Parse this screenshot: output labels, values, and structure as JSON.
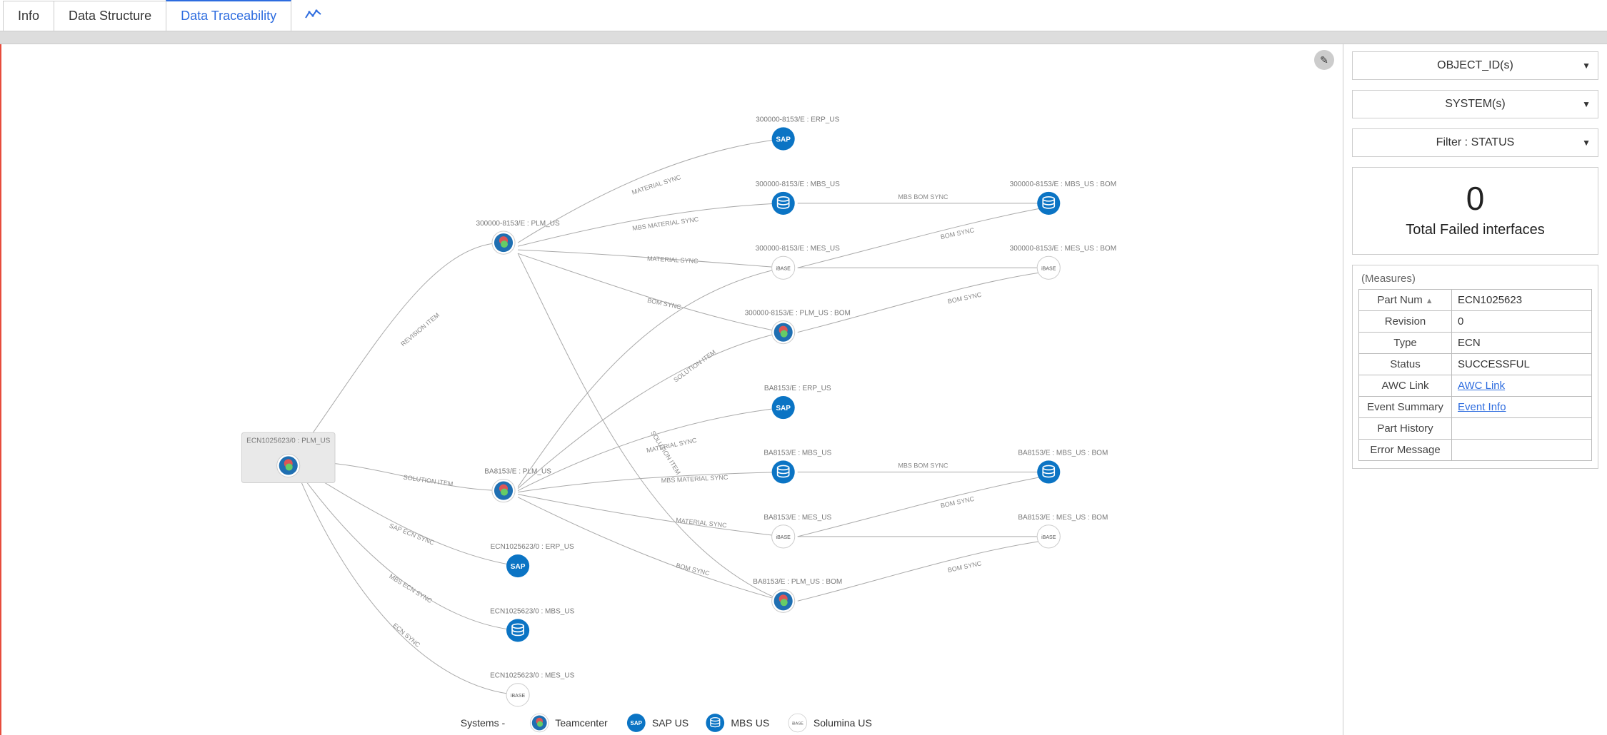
{
  "tabs": {
    "info": "Info",
    "structure": "Data Structure",
    "trace": "Data Traceability"
  },
  "filters": {
    "object": "OBJECT_ID(s)",
    "system": "SYSTEM(s)",
    "status": "Filter : STATUS"
  },
  "kpi": {
    "value": "0",
    "label": "Total Failed interfaces"
  },
  "measures": {
    "header": "(Measures)",
    "rows": {
      "partnum": {
        "k": "Part Num",
        "v": "ECN1025623"
      },
      "revision": {
        "k": "Revision",
        "v": "0"
      },
      "type": {
        "k": "Type",
        "v": "ECN"
      },
      "status": {
        "k": "Status",
        "v": "SUCCESSFUL"
      },
      "awc": {
        "k": "AWC Link",
        "v": "AWC Link"
      },
      "evsum": {
        "k": "Event Summary",
        "v": "Event Info"
      },
      "parthist": {
        "k": "Part History",
        "v": ""
      },
      "errmsg": {
        "k": "Error Message",
        "v": ""
      }
    }
  },
  "legend": {
    "title": "Systems -",
    "items": {
      "tc": "Teamcenter",
      "sap": "SAP US",
      "mbs": "MBS US",
      "sol": "Solumina US"
    }
  },
  "graph": {
    "edge_labels": {
      "revision": "REVISION ITEM",
      "solution": "SOLUTION ITEM",
      "bom_sync": "BOM SYNC",
      "material_sync": "MATERIAL SYNC",
      "mbs_material_sync": "MBS MATERIAL SYNC",
      "mbs_bom_sync": "MBS BOM SYNC",
      "sap_ecn_sync": "SAP ECN SYNC",
      "mbs_ecn_sync": "MBS ECN SYNC",
      "ecn_sync": "ECN SYNC"
    },
    "nodes": {
      "root": {
        "label": "ECN1025623/0 : PLM_US"
      },
      "tc_a": {
        "label": "300000-8153/E : PLM_US"
      },
      "tc_b": {
        "label": "BA8153/E : PLM_US"
      },
      "sap_ecn": {
        "label": "ECN1025623/0 : ERP_US"
      },
      "mbs_ecn": {
        "label": "ECN1025623/0 : MBS_US"
      },
      "sol_ecn": {
        "label": "ECN1025623/0 : MES_US"
      },
      "a_sap": {
        "label": "300000-8153/E : ERP_US"
      },
      "a_mbs": {
        "label": "300000-8153/E : MBS_US"
      },
      "a_sol": {
        "label": "300000-8153/E : MES_US"
      },
      "a_plmb": {
        "label": "300000-8153/E : PLM_US : BOM"
      },
      "a_mbs_b": {
        "label": "300000-8153/E : MBS_US : BOM"
      },
      "a_sol_b": {
        "label": "300000-8153/E : MES_US : BOM"
      },
      "b_sap": {
        "label": "BA8153/E : ERP_US"
      },
      "b_mbs": {
        "label": "BA8153/E : MBS_US"
      },
      "b_sol": {
        "label": "BA8153/E : MES_US"
      },
      "b_plmb": {
        "label": "BA8153/E : PLM_US : BOM"
      },
      "b_mbs_b": {
        "label": "BA8153/E : MBS_US : BOM"
      },
      "b_sol_b": {
        "label": "BA8153/E : MES_US : BOM"
      }
    }
  }
}
